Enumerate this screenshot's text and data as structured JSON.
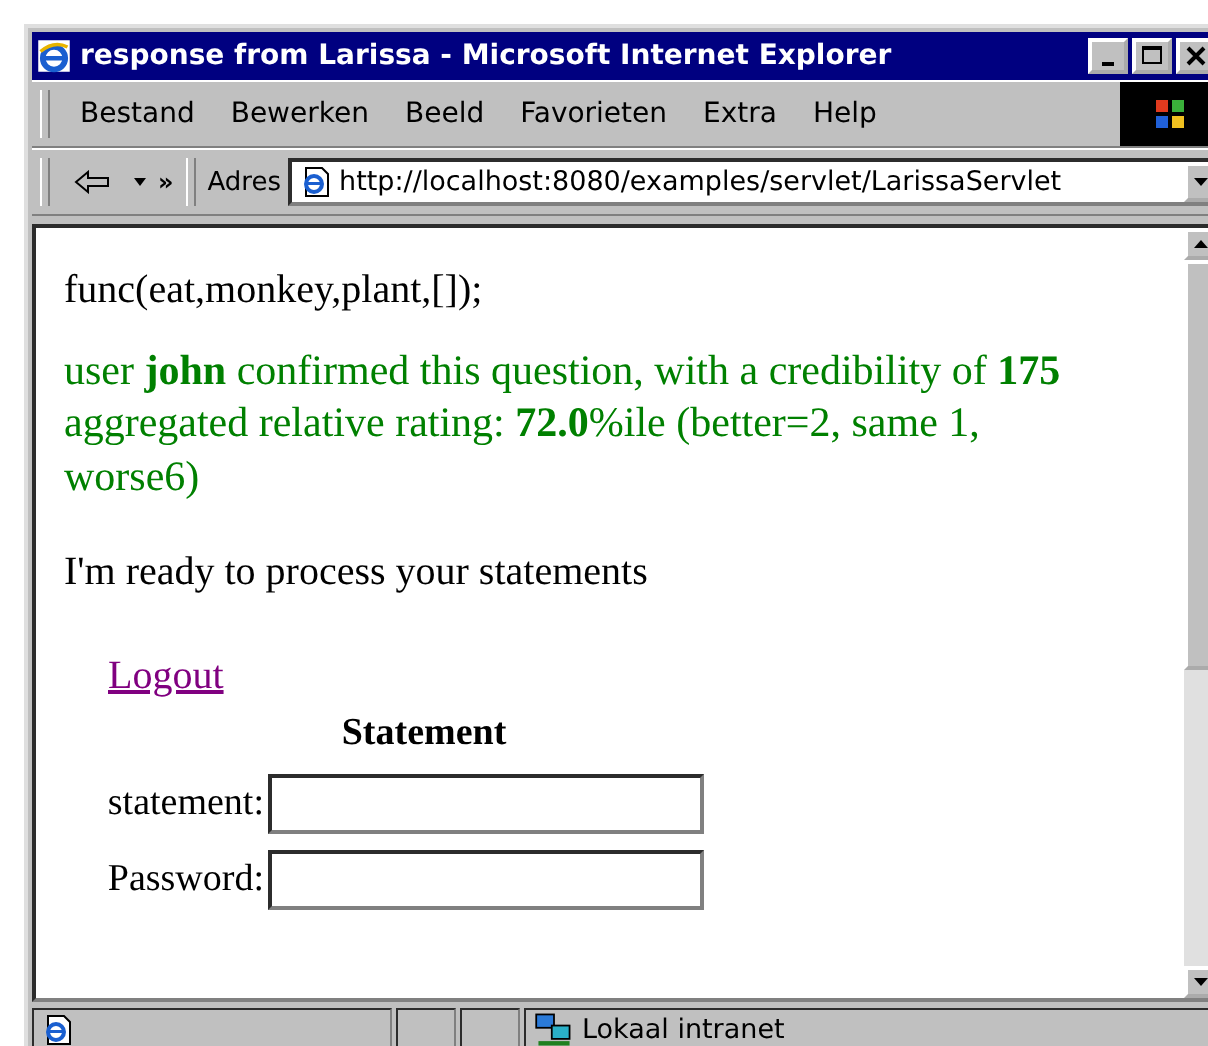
{
  "window": {
    "title": "response from Larissa - Microsoft Internet Explorer"
  },
  "menu": [
    "Bestand",
    "Bewerken",
    "Beeld",
    "Favorieten",
    "Extra",
    "Help"
  ],
  "toolbar": {
    "chevron": "»",
    "address_label": "Adres",
    "address": "http://localhost:8080/examples/servlet/LarissaServlet"
  },
  "content": {
    "code_line": "func(eat,monkey,plant,[]);",
    "result": "user **john** confirmed this question, with a credibility of **175** aggregated relative rating: **72.0**%ile (better=2, same 1, worse6)",
    "ready": "I'm ready to process your statements",
    "logout_link": "Logout",
    "form": {
      "heading": "Statement",
      "fields": [
        {
          "label": "statement:"
        },
        {
          "label": "Password:"
        }
      ]
    }
  },
  "status_bar": {
    "zone": "Lokaal intranet"
  }
}
